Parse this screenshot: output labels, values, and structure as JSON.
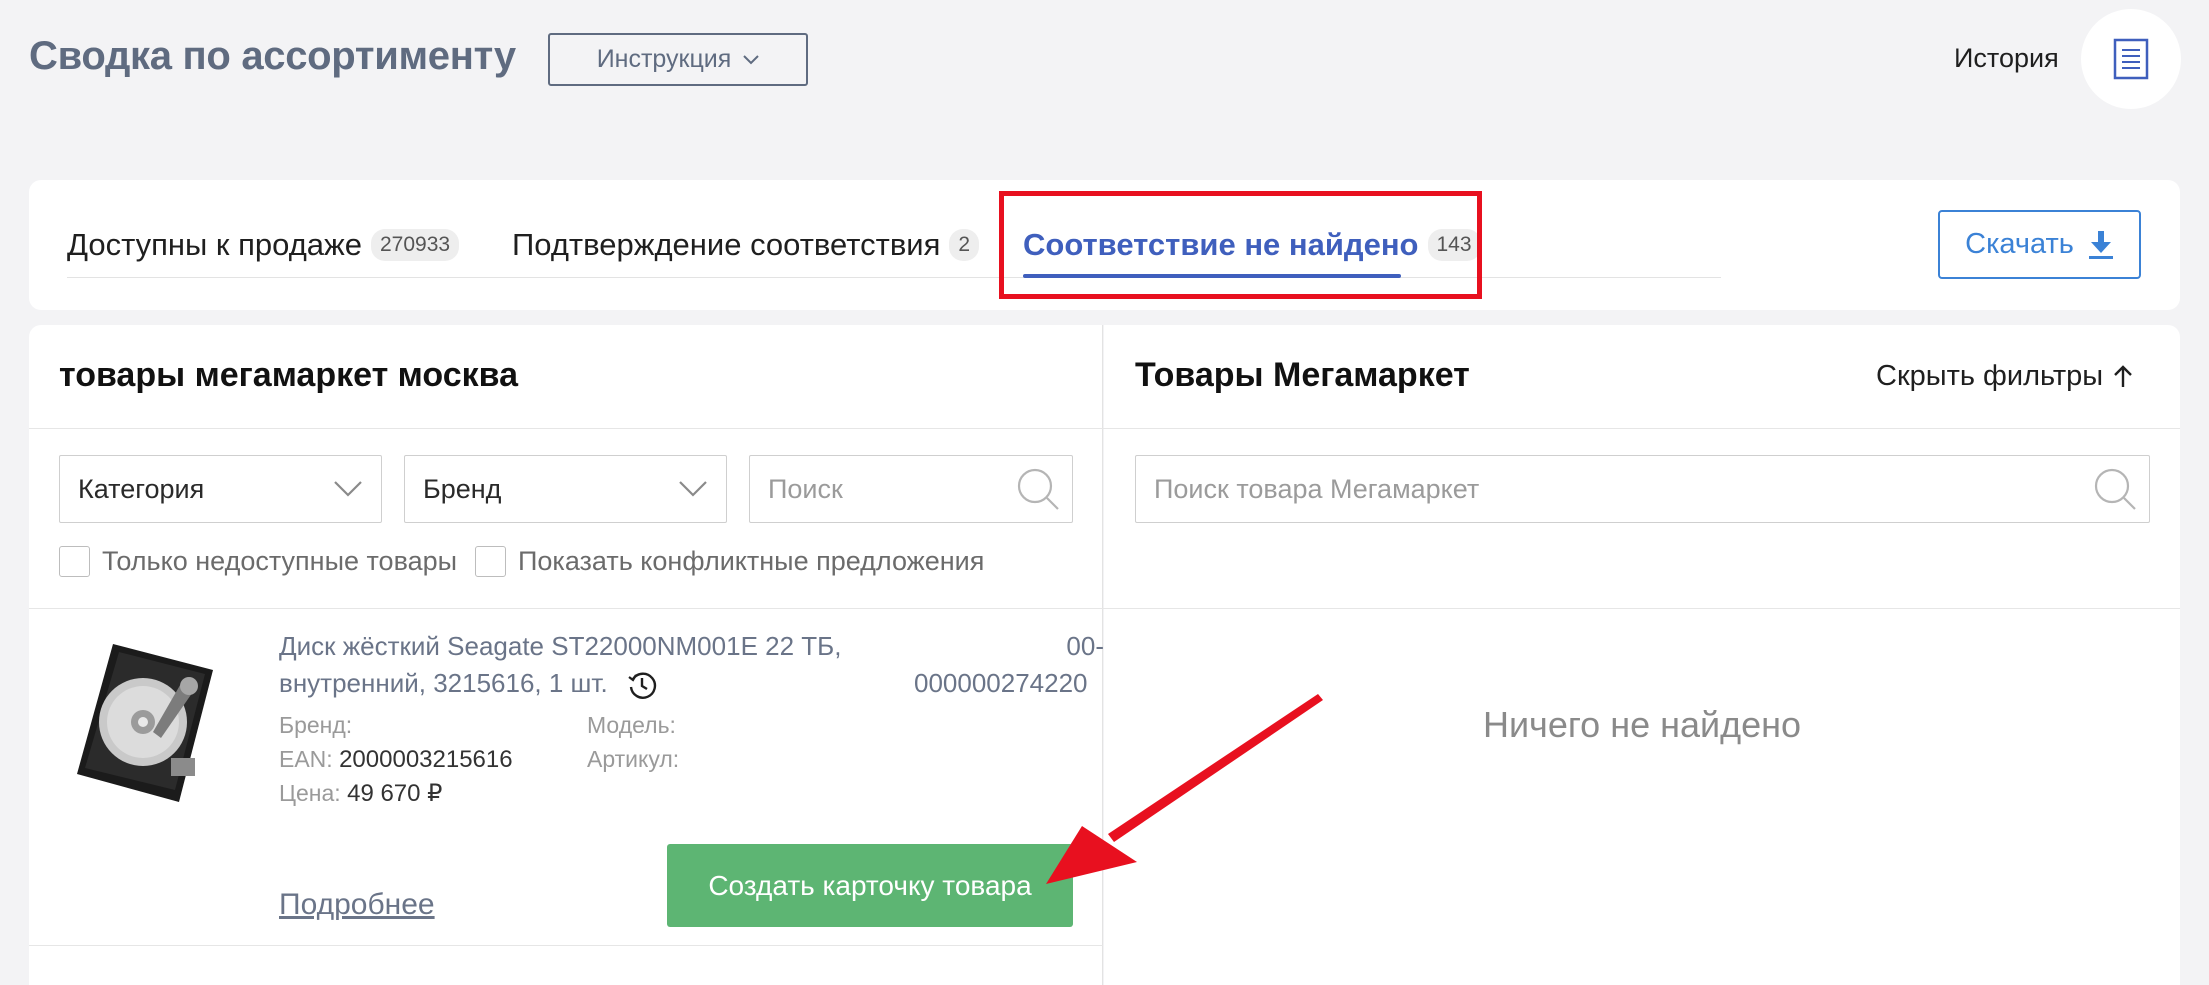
{
  "header": {
    "title": "Сводка по ассортименту",
    "instruction_label": "Инструкция",
    "history_label": "История"
  },
  "tabs": [
    {
      "label": "Доступны к продаже",
      "count": "270933"
    },
    {
      "label": "Подтверждение соответствия",
      "count": "2"
    },
    {
      "label": "Соответствие не найдено",
      "count": "143"
    }
  ],
  "download_label": "Скачать",
  "left_panel": {
    "title": "товары мегамаркет москва",
    "category_label": "Категория",
    "brand_label": "Бренд",
    "search_placeholder": "Поиск",
    "only_unavailable_label": "Только недоступные товары",
    "show_conflicts_label": "Показать конфликтные предложения"
  },
  "right_panel": {
    "title": "Товары Мегамаркет",
    "hide_filters_label": "Скрыть фильтры",
    "search_placeholder": "Поиск товара Мегамаркет",
    "empty_message": "Ничего не найдено"
  },
  "product": {
    "name_line1": "Диск жёсткий Seagate ST22000NM001E 22 ТБ,",
    "name_line2": "внутренний, 3215616, 1 шт.",
    "code_line1": "00-",
    "code_line2": "000000274220",
    "brand_label": "Бренд:",
    "brand_value": "",
    "ean_label": "EAN:",
    "ean_value": "2000003215616",
    "price_label": "Цена:",
    "price_value": "49 670 ₽",
    "model_label": "Модель:",
    "model_value": "",
    "article_label": "Артикул:",
    "article_value": "",
    "details_link": "Подробнее",
    "create_button": "Создать карточку товара"
  },
  "colors": {
    "accent_blue": "#3f5fbd",
    "download_blue": "#3b82d6",
    "create_green": "#5db573",
    "highlight_red": "#e8101f",
    "title_gray": "#5f6b80"
  },
  "icons": {
    "instruction_chevron": "chevron-down-icon",
    "history": "document-icon",
    "download": "download-icon",
    "hide_filters": "arrow-up-icon",
    "dropdown": "chevron-down-icon",
    "search": "search-icon",
    "product_history": "history-clock-icon"
  }
}
